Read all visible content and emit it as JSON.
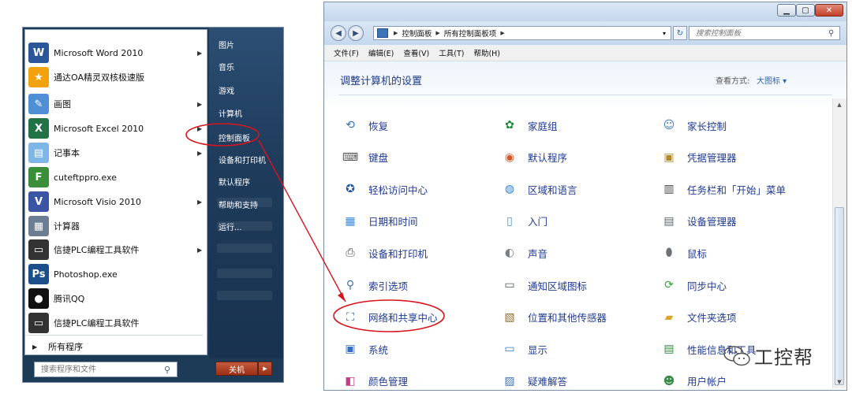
{
  "start_menu": {
    "programs": [
      {
        "label": "Microsoft Word 2010",
        "icon": "word-icon",
        "arrow": true,
        "color": "#2b579a",
        "glyph": "W"
      },
      {
        "label": "通达OA精灵双核极速版",
        "icon": "star-icon",
        "arrow": false,
        "color": "#f2a20d",
        "glyph": "★"
      },
      {
        "label": "画图",
        "icon": "paint-icon",
        "arrow": true,
        "color": "#4f8fd6",
        "glyph": "✎"
      },
      {
        "label": "Microsoft Excel 2010",
        "icon": "excel-icon",
        "arrow": true,
        "color": "#217346",
        "glyph": "X"
      },
      {
        "label": "记事本",
        "icon": "notepad-icon",
        "arrow": true,
        "color": "#7fb6e8",
        "glyph": "▤"
      },
      {
        "label": "cuteftppro.exe",
        "icon": "ftp-icon",
        "arrow": false,
        "color": "#3b8f3b",
        "glyph": "F"
      },
      {
        "label": "Microsoft Visio 2010",
        "icon": "visio-icon",
        "arrow": true,
        "color": "#3955a3",
        "glyph": "V"
      },
      {
        "label": "计算器",
        "icon": "calculator-icon",
        "arrow": false,
        "color": "#6d7e93",
        "glyph": "▦"
      },
      {
        "label": "信捷PLC编程工具软件",
        "icon": "plc-icon",
        "arrow": true,
        "color": "#333333",
        "glyph": "▭"
      },
      {
        "label": "Photoshop.exe",
        "icon": "photoshop-icon",
        "arrow": false,
        "color": "#1b4f8c",
        "glyph": "Ps"
      },
      {
        "label": "腾讯QQ",
        "icon": "qq-icon",
        "arrow": false,
        "color": "#111111",
        "glyph": "●"
      },
      {
        "label": "信捷PLC编程工具软件",
        "icon": "plc-icon",
        "arrow": false,
        "color": "#333333",
        "glyph": "▭"
      }
    ],
    "all_programs": "所有程序",
    "search_placeholder": "搜索程序和文件",
    "right_items": [
      "图片",
      "音乐",
      "游戏",
      "计算机",
      "控制面板",
      "设备和打印机",
      "默认程序",
      "帮助和支持",
      "运行..."
    ],
    "shutdown_label": "关机"
  },
  "window": {
    "address": [
      "控制面板",
      "所有控制面板项"
    ],
    "search_placeholder": "搜索控制面板",
    "menus": [
      "文件(F)",
      "编辑(E)",
      "查看(V)",
      "工具(T)",
      "帮助(H)"
    ],
    "title": "调整计算机的设置",
    "view_by_label": "查看方式:",
    "view_by_value": "大图标 ▾",
    "items": [
      {
        "label": "恢复",
        "icon": "recovery-icon",
        "glyph": "⟲",
        "color": "#2c6fb5"
      },
      {
        "label": "家庭组",
        "icon": "homegroup-icon",
        "glyph": "✿",
        "color": "#1f8a3a"
      },
      {
        "label": "家长控制",
        "icon": "parental-controls-icon",
        "glyph": "☺",
        "color": "#3a78c2"
      },
      {
        "label": "键盘",
        "icon": "keyboard-icon",
        "glyph": "⌨",
        "color": "#555555"
      },
      {
        "label": "默认程序",
        "icon": "default-programs-icon",
        "glyph": "◉",
        "color": "#d9541e"
      },
      {
        "label": "凭据管理器",
        "icon": "credential-manager-icon",
        "glyph": "▣",
        "color": "#b08a2a"
      },
      {
        "label": "轻松访问中心",
        "icon": "ease-of-access-icon",
        "glyph": "✪",
        "color": "#2250a0"
      },
      {
        "label": "区域和语言",
        "icon": "region-language-icon",
        "glyph": "◍",
        "color": "#2d7fc8"
      },
      {
        "label": "任务栏和「开始」菜单",
        "icon": "taskbar-icon",
        "glyph": "▥",
        "color": "#444444"
      },
      {
        "label": "日期和时间",
        "icon": "date-time-icon",
        "glyph": "▦",
        "color": "#3c8ad8"
      },
      {
        "label": "入门",
        "icon": "getting-started-icon",
        "glyph": "▯",
        "color": "#4a8fd0"
      },
      {
        "label": "设备管理器",
        "icon": "device-manager-icon",
        "glyph": "▤",
        "color": "#5a6472"
      },
      {
        "label": "设备和打印机",
        "icon": "devices-printers-icon",
        "glyph": "⎙",
        "color": "#4a4f57"
      },
      {
        "label": "声音",
        "icon": "sound-icon",
        "glyph": "◐",
        "color": "#7a7f86"
      },
      {
        "label": "鼠标",
        "icon": "mouse-icon",
        "glyph": "⬮",
        "color": "#6c7077"
      },
      {
        "label": "索引选项",
        "icon": "indexing-options-icon",
        "glyph": "⚲",
        "color": "#3e6fa8"
      },
      {
        "label": "通知区域图标",
        "icon": "notification-area-icon",
        "glyph": "▭",
        "color": "#4d5560"
      },
      {
        "label": "同步中心",
        "icon": "sync-center-icon",
        "glyph": "⟳",
        "color": "#2fa33a"
      },
      {
        "label": "网络和共享中心",
        "icon": "network-sharing-icon",
        "glyph": "⛶",
        "color": "#2a62b3"
      },
      {
        "label": "位置和其他传感器",
        "icon": "location-sensors-icon",
        "glyph": "▧",
        "color": "#8c6a2b"
      },
      {
        "label": "文件夹选项",
        "icon": "folder-options-icon",
        "glyph": "▰",
        "color": "#d9a62a"
      },
      {
        "label": "系统",
        "icon": "system-icon",
        "glyph": "▣",
        "color": "#3571c2"
      },
      {
        "label": "显示",
        "icon": "display-icon",
        "glyph": "▭",
        "color": "#2f7ad0"
      },
      {
        "label": "性能信息和工具",
        "icon": "performance-icon",
        "glyph": "▤",
        "color": "#2f8a3a"
      },
      {
        "label": "颜色管理",
        "icon": "color-management-icon",
        "glyph": "◧",
        "color": "#c43d8a"
      },
      {
        "label": "疑难解答",
        "icon": "troubleshooting-icon",
        "glyph": "▨",
        "color": "#3d70b8"
      },
      {
        "label": "用户帐户",
        "icon": "user-accounts-icon",
        "glyph": "☻",
        "color": "#3a8a4a"
      }
    ]
  },
  "watermark": {
    "text": "工控帮"
  },
  "colors": {
    "annotation": "#d9141c",
    "link": "#1f3a93",
    "title": "#1e3a8a"
  }
}
